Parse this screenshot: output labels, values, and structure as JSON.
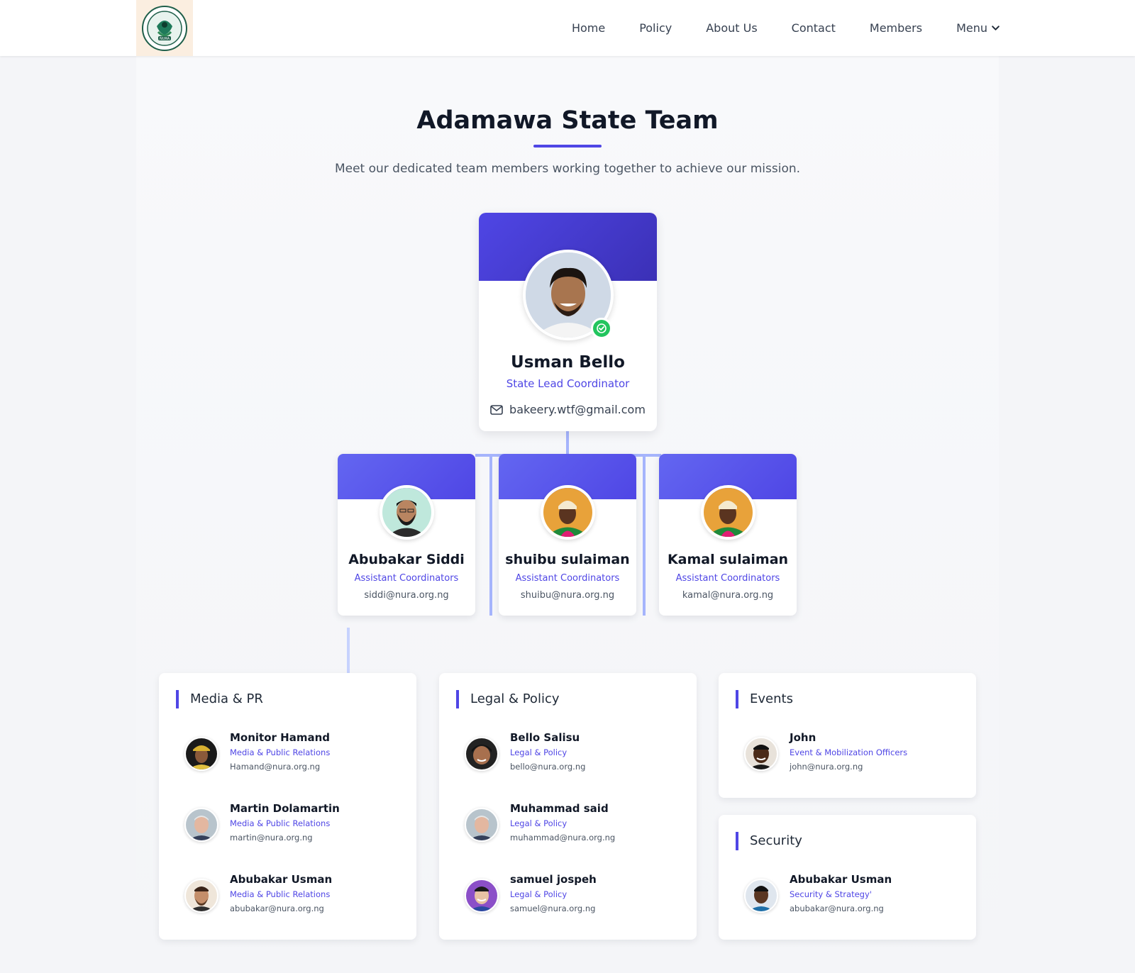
{
  "nav": {
    "items": [
      "Home",
      "Policy",
      "About Us",
      "Contact",
      "Members"
    ],
    "menu_label": "Menu",
    "logo_text": "NURA"
  },
  "page": {
    "title": "Adamawa State Team",
    "subtitle": "Meet our dedicated team members working together to achieve our mission."
  },
  "lead": {
    "name": "Usman Bello",
    "role": "State Lead Coordinator",
    "email": "bakeery.wtf@gmail.com"
  },
  "assistants": [
    {
      "name": "Abubakar Siddi",
      "role": "Assistant Coordinators",
      "email": "siddi@nura.org.ng"
    },
    {
      "name": "shuibu sulaiman",
      "role": "Assistant Coordinators",
      "email": "shuibu@nura.org.ng"
    },
    {
      "name": "Kamal sulaiman",
      "role": "Assistant Coordinators",
      "email": "kamal@nura.org.ng"
    }
  ],
  "departments": [
    {
      "title": "Media & PR",
      "members": [
        {
          "name": "Monitor Hamand",
          "role": "Media & Public Relations",
          "email": "Hamand@nura.org.ng"
        },
        {
          "name": "Martin Dolamartin",
          "role": "Media & Public Relations",
          "email": "martin@nura.org.ng"
        },
        {
          "name": "Abubakar Usman",
          "role": "Media & Public Relations",
          "email": "abubakar@nura.org.ng"
        }
      ]
    },
    {
      "title": "Legal & Policy",
      "members": [
        {
          "name": "Bello Salisu",
          "role": "Legal & Policy",
          "email": "bello@nura.org.ng"
        },
        {
          "name": "Muhammad said",
          "role": "Legal & Policy",
          "email": "muhammad@nura.org.ng"
        },
        {
          "name": "samuel jospeh",
          "role": "Legal & Policy",
          "email": "samuel@nura.org.ng"
        }
      ]
    },
    {
      "title": "Events",
      "members": [
        {
          "name": "John",
          "role": "Event & Mobilization Officers",
          "email": "john@nura.org.ng"
        }
      ]
    },
    {
      "title": "Security",
      "members": [
        {
          "name": "Abubakar Usman",
          "role": "Security & Strategy'",
          "email": "abubakar@nura.org.ng"
        }
      ]
    }
  ],
  "colors": {
    "accent": "#4f46e5",
    "connector": "#a5b4fc",
    "verified": "#22c55e",
    "background": "#f4f5f8"
  }
}
